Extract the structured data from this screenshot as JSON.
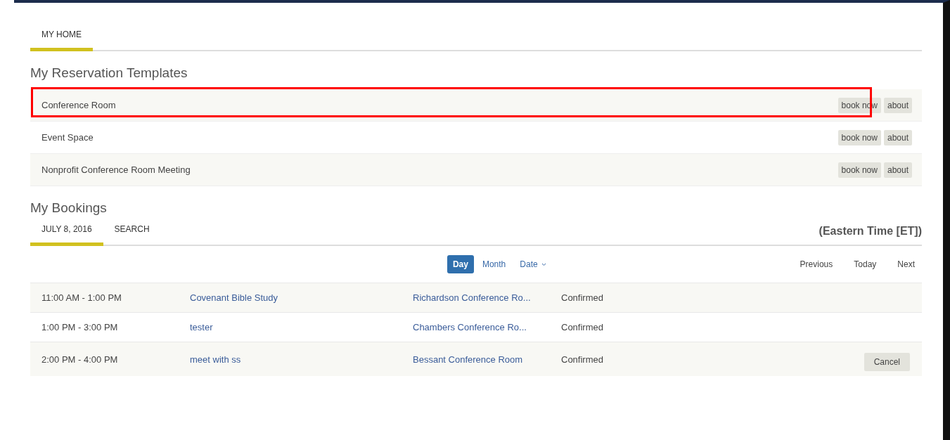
{
  "top_tabs": [
    {
      "label": "MY HOME",
      "selected": true
    }
  ],
  "templates": {
    "heading": "My Reservation Templates",
    "rows": [
      {
        "name": "Conference Room",
        "highlighted": true,
        "book": "book now",
        "about": "about"
      },
      {
        "name": "Event Space",
        "highlighted": false,
        "book": "book now",
        "about": "about"
      },
      {
        "name": "Nonprofit Conference Room Meeting",
        "highlighted": false,
        "book": "book now",
        "about": "about"
      }
    ]
  },
  "bookings": {
    "heading": "My Bookings",
    "tabs": [
      {
        "label": "JULY 8, 2016",
        "selected": true
      },
      {
        "label": "SEARCH",
        "selected": false
      }
    ],
    "timezone": "(Eastern Time [ET])",
    "views": [
      {
        "label": "Day",
        "selected": true,
        "dropdown": false
      },
      {
        "label": "Month",
        "selected": false,
        "dropdown": false
      },
      {
        "label": "Date",
        "selected": false,
        "dropdown": true
      }
    ],
    "nav": [
      "Previous",
      "Today",
      "Next"
    ],
    "rows": [
      {
        "time": "11:00 AM - 1:00 PM",
        "title": "Covenant Bible Study",
        "location": "Richardson Conference Ro...",
        "status": "Confirmed"
      },
      {
        "time": "1:00 PM - 3:00 PM",
        "title": "tester",
        "location": "Chambers Conference Ro...",
        "status": "Confirmed"
      },
      {
        "time": "2:00 PM - 4:00 PM",
        "title": "meet with ss",
        "location": "Bessant Conference Room",
        "status": "Confirmed",
        "cancel": "Cancel"
      }
    ]
  }
}
